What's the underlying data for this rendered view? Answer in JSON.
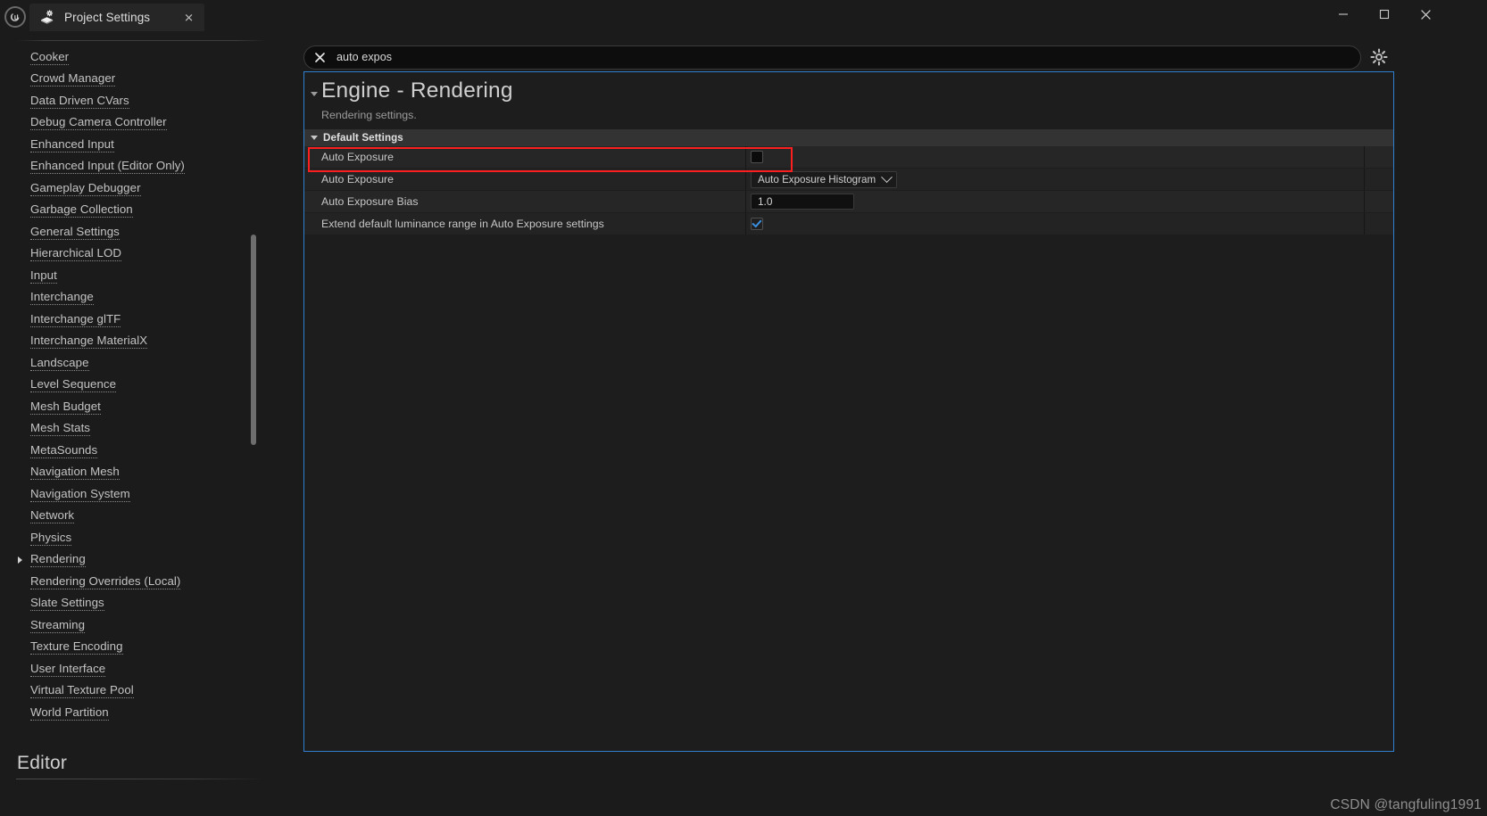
{
  "window": {
    "app_logo": "unreal-engine-logo",
    "tab_title": "Project Settings",
    "tab_icon": "project-settings-icon",
    "close_glyph": "✕",
    "minimize_glyph": "—",
    "maximize_glyph": "□",
    "window_close_glyph": "✕"
  },
  "sidebar": {
    "items": [
      {
        "label": "Cooker",
        "expandable": false
      },
      {
        "label": "Crowd Manager",
        "expandable": false
      },
      {
        "label": "Data Driven CVars",
        "expandable": false
      },
      {
        "label": "Debug Camera Controller",
        "expandable": false
      },
      {
        "label": "Enhanced Input",
        "expandable": false
      },
      {
        "label": "Enhanced Input (Editor Only)",
        "expandable": false
      },
      {
        "label": "Gameplay Debugger",
        "expandable": false
      },
      {
        "label": "Garbage Collection",
        "expandable": false
      },
      {
        "label": "General Settings",
        "expandable": false
      },
      {
        "label": "Hierarchical LOD",
        "expandable": false
      },
      {
        "label": "Input",
        "expandable": false
      },
      {
        "label": "Interchange",
        "expandable": false
      },
      {
        "label": "Interchange glTF",
        "expandable": false
      },
      {
        "label": "Interchange MaterialX",
        "expandable": false
      },
      {
        "label": "Landscape",
        "expandable": false
      },
      {
        "label": "Level Sequence",
        "expandable": false
      },
      {
        "label": "Mesh Budget",
        "expandable": false
      },
      {
        "label": "Mesh Stats",
        "expandable": false
      },
      {
        "label": "MetaSounds",
        "expandable": false
      },
      {
        "label": "Navigation Mesh",
        "expandable": false
      },
      {
        "label": "Navigation System",
        "expandable": false
      },
      {
        "label": "Network",
        "expandable": false
      },
      {
        "label": "Physics",
        "expandable": false
      },
      {
        "label": "Rendering",
        "expandable": true
      },
      {
        "label": "Rendering Overrides (Local)",
        "expandable": false
      },
      {
        "label": "Slate Settings",
        "expandable": false
      },
      {
        "label": "Streaming",
        "expandable": false
      },
      {
        "label": "Texture Encoding",
        "expandable": false
      },
      {
        "label": "User Interface",
        "expandable": false
      },
      {
        "label": "Virtual Texture Pool",
        "expandable": false
      },
      {
        "label": "World Partition",
        "expandable": false
      }
    ],
    "section_header": "Editor"
  },
  "search": {
    "value": "auto expos",
    "placeholder": "Search",
    "clear_icon": "close-icon",
    "settings_icon": "gear-icon"
  },
  "category": {
    "title": "Engine - Rendering",
    "subtitle": "Rendering settings.",
    "group_label": "Default Settings"
  },
  "properties": [
    {
      "name": "Auto Exposure",
      "control": "checkbox",
      "checked": false,
      "highlighted": true
    },
    {
      "name": "Auto Exposure",
      "control": "dropdown",
      "value": "Auto Exposure Histogram",
      "highlighted": false
    },
    {
      "name": "Auto Exposure Bias",
      "control": "numeric",
      "value": "1.0",
      "highlighted": false
    },
    {
      "name": "Extend default luminance range in Auto Exposure settings",
      "control": "checkbox",
      "checked": true,
      "highlighted": false
    }
  ],
  "watermark": "CSDN @tangfuling1991",
  "colors": {
    "accent_border": "#2f80d0",
    "highlight_red": "#fb1f1f",
    "checkbox_check": "#3a8fe0",
    "window_bg": "#1b1b1b",
    "panel_bg": "#1d1d1d",
    "row_bg": "#262626",
    "group_header_bg": "#333333"
  }
}
